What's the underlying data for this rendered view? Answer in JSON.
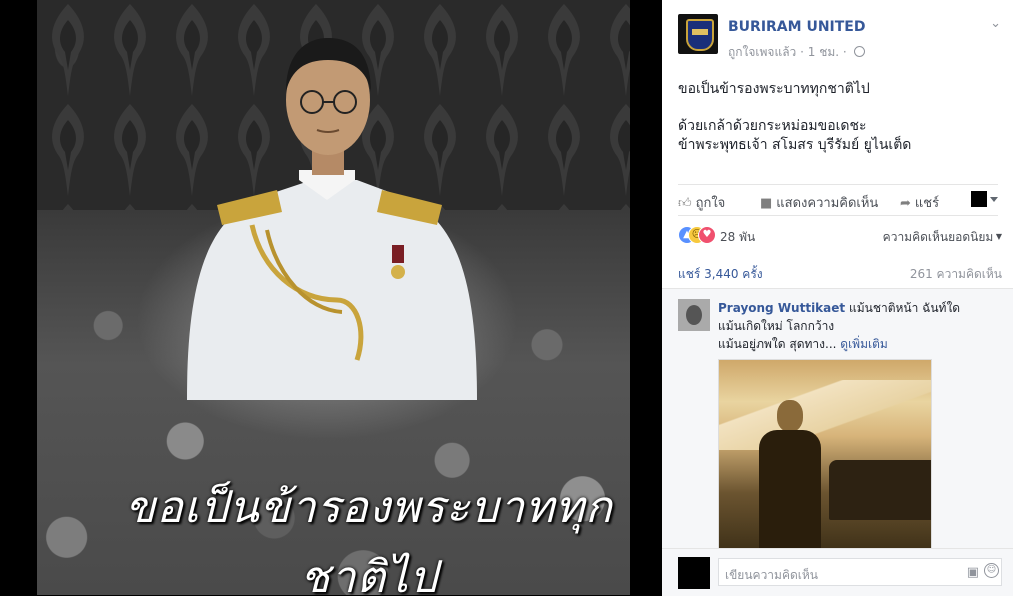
{
  "photo": {
    "caption": "ขอเป็นข้ารองพระบาททุกชาติไป"
  },
  "post": {
    "page_name": "BURIRAM UNITED",
    "meta_liked": "ถูกใจเพจแล้ว",
    "meta_time": "1 ชม.",
    "text_line1": "ขอเป็นข้ารองพระบาททุกชาติไป",
    "text_line2": "ด้วยเกล้าด้วยกระหม่อมขอเดชะ",
    "text_line3": "ข้าพระพุทธเจ้า สโมสร บุรีรัมย์ ยูไนเต็ด"
  },
  "actions": {
    "like": "ถูกใจ",
    "comment": "แสดงความคิดเห็น",
    "share": "แชร์"
  },
  "reactions": {
    "count": "28 พัน",
    "top_comments": "ความคิดเห็นยอดนิยม"
  },
  "stats": {
    "shares": "แชร์ 3,440 ครั้ง",
    "comments": "261 ความคิดเห็น"
  },
  "comment": {
    "author": "Prayong Wuttikaet",
    "text1": "แม้นชาติหน้า ฉันท์ใด",
    "text2": "แม้นเกิดใหม่ โลกกว้าง",
    "text3": "แม้นอยู่ภพใด สุดทาง...",
    "see_more": "ดูเพิ่มเติม"
  },
  "composer": {
    "placeholder": "เขียนความคิดเห็น"
  },
  "icons": {
    "like": "thumbs-up-icon",
    "comment": "comment-icon",
    "share": "share-arrow-icon",
    "camera": "camera-icon",
    "emoji": "smile-icon"
  },
  "colors": {
    "link": "#365899",
    "text": "#1d2129",
    "meta": "#90949c"
  }
}
